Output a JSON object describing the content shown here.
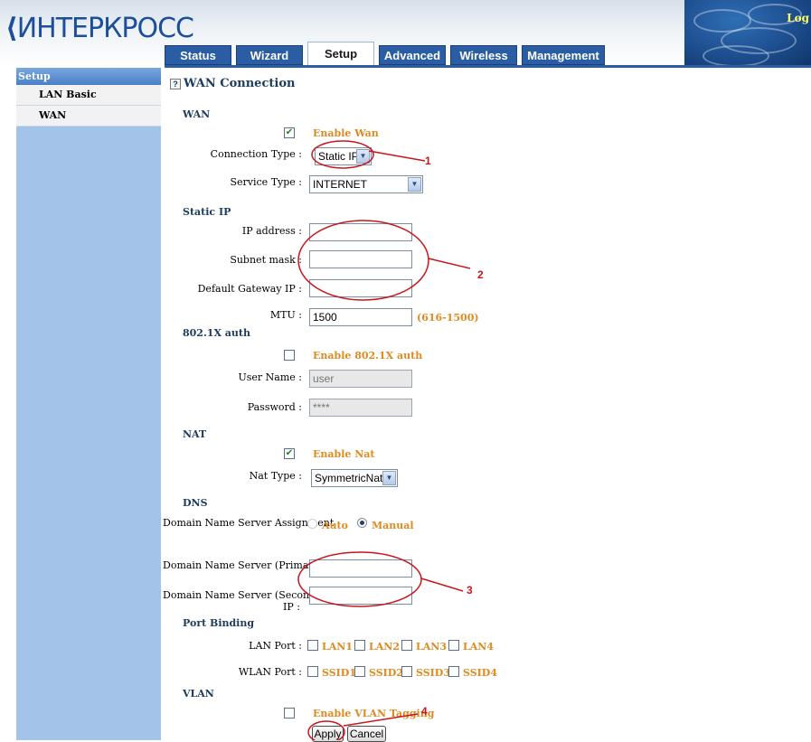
{
  "header": {
    "logo_text": "ИНТЕРКРОСС",
    "logout": "Log",
    "tabs": [
      "Status",
      "Wizard",
      "Setup",
      "Advanced",
      "Wireless",
      "Management"
    ],
    "active_tab": "Setup"
  },
  "sidebar": {
    "title": "Setup",
    "items": [
      {
        "label": "LAN Basic"
      },
      {
        "label": "WAN"
      }
    ]
  },
  "page": {
    "help_icon": "?",
    "title": "WAN Connection"
  },
  "wan": {
    "section": "WAN",
    "enable_label": "Enable Wan",
    "enable_checked": true,
    "connection_type_label": "Connection Type :",
    "connection_type_value": "Static IP",
    "service_type_label": "Service Type :",
    "service_type_value": "INTERNET"
  },
  "static_ip": {
    "section": "Static IP",
    "ip_label": "IP address :",
    "ip_value": "",
    "mask_label": "Subnet mask :",
    "mask_value": "",
    "gateway_label": "Default Gateway IP :",
    "gateway_value": "",
    "mtu_label": "MTU :",
    "mtu_value": "1500",
    "mtu_range": "(616-1500)"
  },
  "auth": {
    "section": "802.1X auth",
    "enable_label": "Enable 802.1X auth",
    "enable_checked": false,
    "user_label": "User Name :",
    "user_value": "user",
    "password_label": "Password :",
    "password_value": "****"
  },
  "nat": {
    "section": "NAT",
    "enable_label": "Enable Nat",
    "enable_checked": true,
    "type_label": "Nat Type :",
    "type_value": "SymmetricNat"
  },
  "dns": {
    "section": "DNS",
    "assignment_label": "Domain Name Server Assignment :",
    "auto_label": "Auto",
    "manual_label": "Manual",
    "selected": "Manual",
    "primary_label_1": "Domain Name Server (Primary) IP",
    "primary_label_2": ":",
    "primary_value": "",
    "secondary_label_1": "Domain Name Server (Secondary )",
    "secondary_label_2": "IP :",
    "secondary_value": ""
  },
  "port_binding": {
    "section": "Port Binding",
    "lan_label": "LAN Port :",
    "lan_ports": [
      "LAN1",
      "LAN2",
      "LAN3",
      "LAN4"
    ],
    "wlan_label": "WLAN Port :",
    "wlan_ports": [
      "SSID1",
      "SSID2",
      "SSID3",
      "SSID4"
    ]
  },
  "vlan": {
    "section": "VLAN",
    "enable_label": "Enable VLAN Tagging",
    "enable_checked": false
  },
  "buttons": {
    "apply": "Apply",
    "cancel": "Cancel"
  },
  "annotations": [
    "1",
    "2",
    "3",
    "4"
  ],
  "colors": {
    "annotation": "#c8161d",
    "tab_blue": "#2a5da3",
    "sidebar": "#a4c3e8",
    "orange_label": "#e08a1e"
  }
}
